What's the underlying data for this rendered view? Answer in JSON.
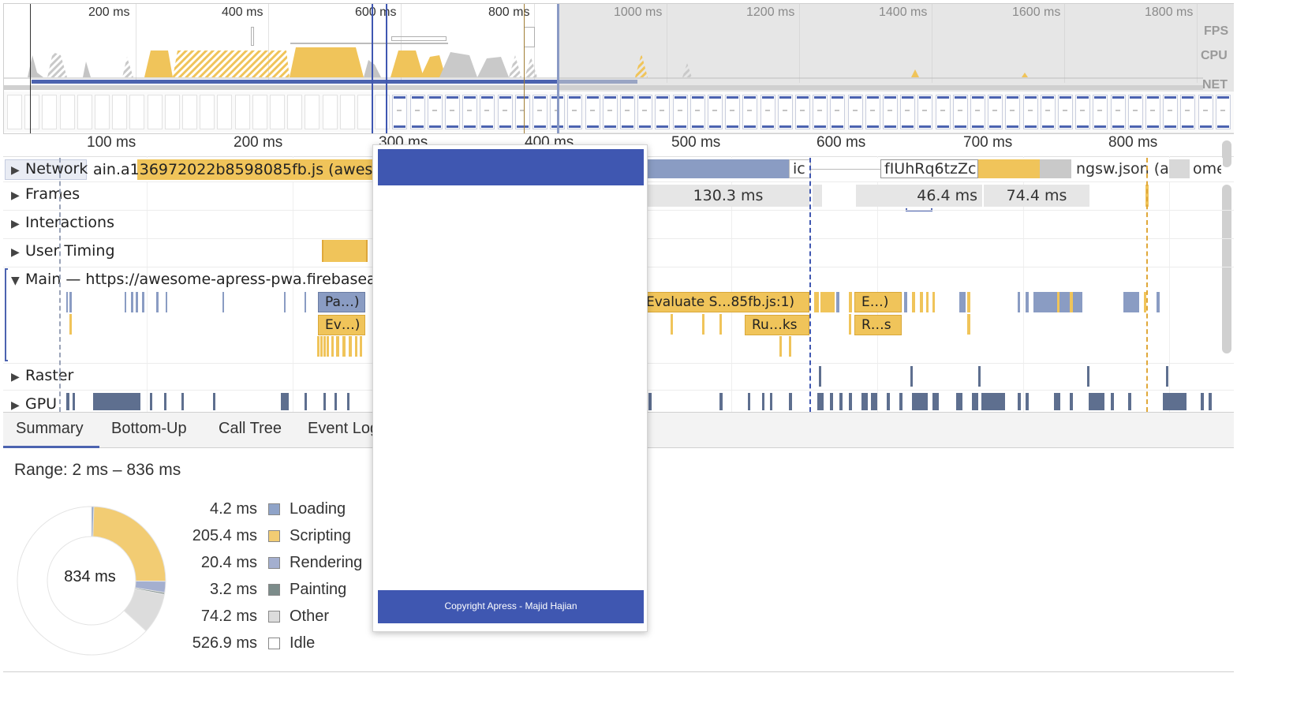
{
  "overview": {
    "ticks": [
      "200 ms",
      "400 ms",
      "600 ms",
      "800 ms",
      "1000 ms",
      "1200 ms",
      "1400 ms",
      "1600 ms",
      "1800 ms"
    ],
    "labels": {
      "fps": "FPS",
      "cpu": "CPU",
      "net": "NET"
    }
  },
  "ruler": {
    "ticks": [
      "100 ms",
      "200 ms",
      "300 ms",
      "400 ms",
      "500 ms",
      "600 ms",
      "700 ms",
      "800 ms"
    ]
  },
  "tracks": {
    "network": {
      "label": "Network",
      "req1": "ain.a136972022b8598085fb.js (aweso",
      "req2": "ic",
      "req3": "fIUhRq6tzZcl",
      "req4": "ngsw.json (a",
      "req5": "ome"
    },
    "frames": {
      "label": "Frames",
      "f1": "130.3 ms",
      "f2": "46.4 ms",
      "f3": "74.4 ms"
    },
    "interactions": {
      "label": "Interactions"
    },
    "user_timing": {
      "label": "User Timing"
    },
    "main": {
      "label": "Main — https://awesome-apress-pwa.firebasea",
      "ev_pa": "Pa…)",
      "ev_ev": "Ev…)",
      "ev_evaluate": "Evaluate S…85fb.js:1)",
      "ev_ruks": "Ru…ks",
      "ev_e": "E…)",
      "ev_rs": "R…s"
    },
    "raster": {
      "label": "Raster"
    },
    "gpu": {
      "label": "GPU"
    }
  },
  "tabs": [
    "Summary",
    "Bottom-Up",
    "Call Tree",
    "Event Log"
  ],
  "summary": {
    "range": "Range: 2 ms – 836 ms",
    "total": "834 ms",
    "items": [
      {
        "value": "4.2 ms",
        "label": "Loading",
        "color": "#8fa3c8",
        "ms": 4.2
      },
      {
        "value": "205.4 ms",
        "label": "Scripting",
        "color": "#f2cc73",
        "ms": 205.4
      },
      {
        "value": "20.4 ms",
        "label": "Rendering",
        "color": "#a4afcf",
        "ms": 20.4
      },
      {
        "value": "3.2 ms",
        "label": "Painting",
        "color": "#7c8c8a",
        "ms": 3.2
      },
      {
        "value": "74.2 ms",
        "label": "Other",
        "color": "#dcdcdc",
        "ms": 74.2
      },
      {
        "value": "526.9 ms",
        "label": "Idle",
        "color": "#ffffff",
        "ms": 526.9
      }
    ]
  },
  "preview": {
    "footer": "Copyright Apress - Majid Hajian",
    "header_color": "#3f57b1"
  }
}
